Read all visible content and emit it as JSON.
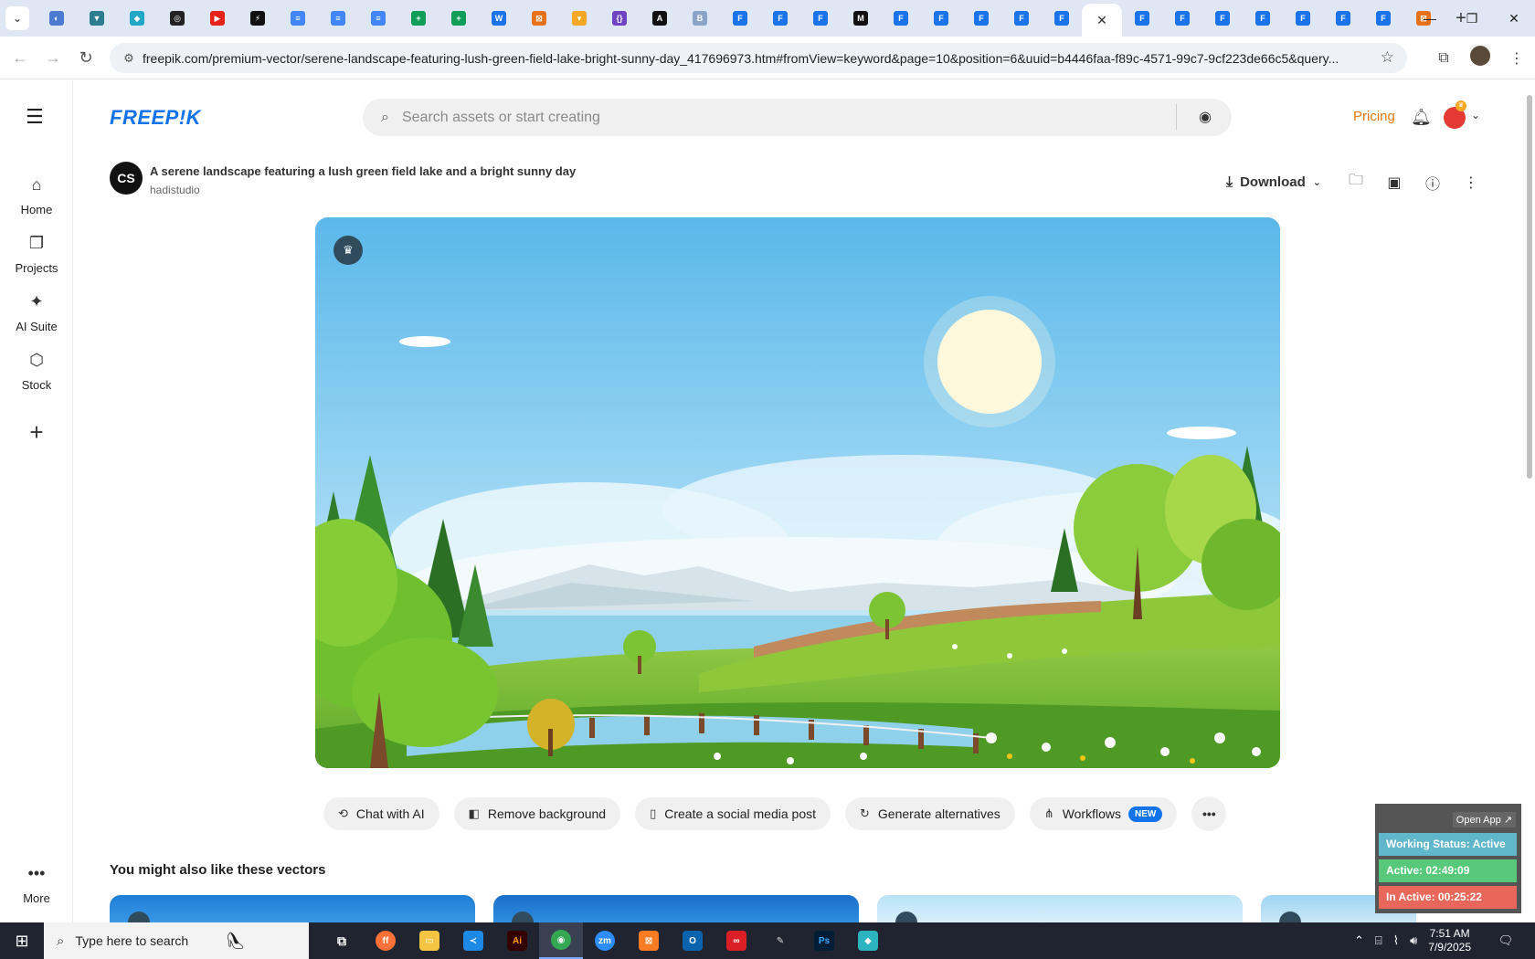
{
  "browser": {
    "url": "freepik.com/premium-vector/serene-landscape-featuring-lush-green-field-lake-bright-sunny-day_417696973.htm#fromView=keyword&page=10&position=6&uuid=b4446faa-f89c-4571-99c7-9cf223de66c5&query...",
    "tabs": [
      {
        "color": "#4a7bd0",
        "glyph": "◐"
      },
      {
        "color": "#2b7d8f",
        "glyph": "▼"
      },
      {
        "color": "#23a7c9",
        "glyph": "◆"
      },
      {
        "color": "#222222",
        "glyph": "◎"
      },
      {
        "color": "#e62117",
        "glyph": "▶"
      },
      {
        "color": "#111111",
        "glyph": "⚡"
      },
      {
        "color": "#4285f4",
        "glyph": "≡"
      },
      {
        "color": "#4285f4",
        "glyph": "≡"
      },
      {
        "color": "#4285f4",
        "glyph": "≡"
      },
      {
        "color": "#0f9d58",
        "glyph": "+"
      },
      {
        "color": "#0f9d58",
        "glyph": "+"
      },
      {
        "color": "#1a73e8",
        "glyph": "W"
      },
      {
        "color": "#e8711c",
        "glyph": "⊠"
      },
      {
        "color": "#f5a623",
        "glyph": "▾"
      },
      {
        "color": "#6f42c1",
        "glyph": "{}"
      },
      {
        "color": "#111111",
        "glyph": "A"
      },
      {
        "color": "#8aa4c8",
        "glyph": "B"
      },
      {
        "color": "#1a73e8",
        "glyph": "F"
      },
      {
        "color": "#1a73e8",
        "glyph": "F"
      },
      {
        "color": "#1a73e8",
        "glyph": "F"
      },
      {
        "color": "#111111",
        "glyph": "M"
      },
      {
        "color": "#1a73e8",
        "glyph": "F"
      },
      {
        "color": "#1a73e8",
        "glyph": "F"
      },
      {
        "color": "#1a73e8",
        "glyph": "F"
      },
      {
        "color": "#1a73e8",
        "glyph": "F"
      },
      {
        "color": "#1a73e8",
        "glyph": "F"
      }
    ],
    "tabs_after": [
      {
        "color": "#1a73e8",
        "glyph": "F"
      },
      {
        "color": "#1a73e8",
        "glyph": "F"
      },
      {
        "color": "#1a73e8",
        "glyph": "F"
      },
      {
        "color": "#1a73e8",
        "glyph": "F"
      },
      {
        "color": "#1a73e8",
        "glyph": "F"
      },
      {
        "color": "#1a73e8",
        "glyph": "F"
      },
      {
        "color": "#1a73e8",
        "glyph": "F"
      },
      {
        "color": "#e8711c",
        "glyph": "⊠"
      }
    ]
  },
  "header": {
    "logo": "FREEP!K",
    "search_placeholder": "Search assets or start creating",
    "pricing": "Pricing"
  },
  "sidebar": {
    "items": [
      {
        "icon": "⌂",
        "label": "Home"
      },
      {
        "icon": "❐",
        "label": "Projects"
      },
      {
        "icon": "✦",
        "label": "AI Suite"
      },
      {
        "icon": "⬡",
        "label": "Stock"
      }
    ],
    "more_label": "More"
  },
  "resource": {
    "avatar_text": "CS",
    "title": "A serene landscape featuring a lush green field lake and a bright sunny day",
    "author": "hadistudio",
    "download_label": "Download"
  },
  "actions": [
    {
      "icon": "⟲",
      "label": "Chat with AI"
    },
    {
      "icon": "◧",
      "label": "Remove background"
    },
    {
      "icon": "▯",
      "label": "Create a social media post"
    },
    {
      "icon": "↻",
      "label": "Generate alternatives"
    },
    {
      "icon": "⋔",
      "label": "Workflows",
      "badge": "NEW"
    }
  ],
  "related": {
    "title": "You might also like these vectors"
  },
  "widget": {
    "open_app": "Open App ↗",
    "status": "Working Status: Active",
    "active": "Active: 02:49:09",
    "inactive": "In Active: 00:25:22",
    "colors": {
      "status": "#5fb7c9",
      "active": "#58c97a",
      "inactive": "#e8675a"
    }
  },
  "taskbar": {
    "search_placeholder": "Type here to search",
    "time": "7:51 AM",
    "date": "7/9/2025"
  }
}
